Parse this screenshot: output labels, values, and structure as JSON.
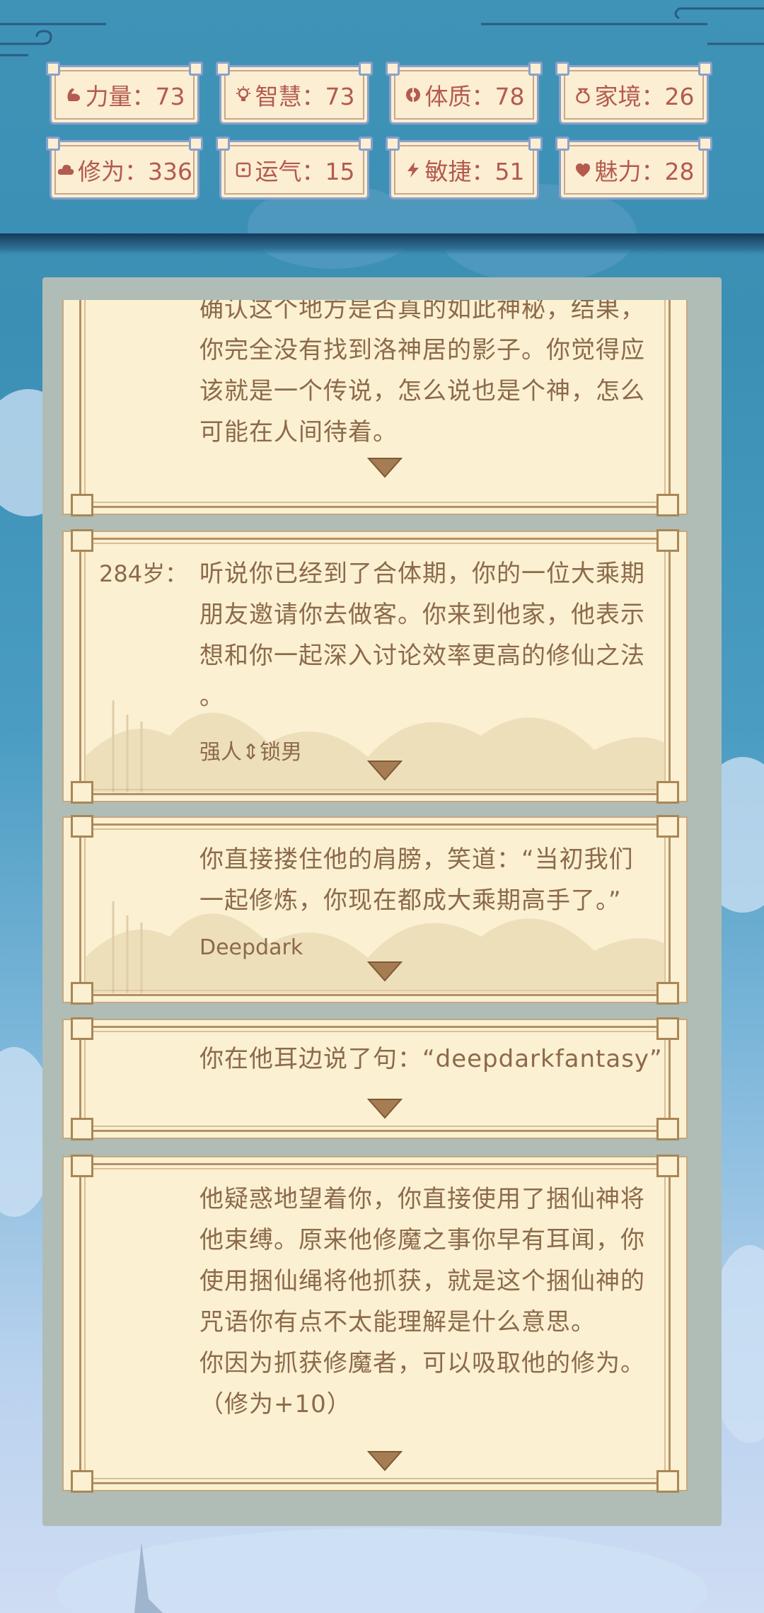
{
  "stats": [
    {
      "label": "力量：73",
      "icon": "muscle-icon"
    },
    {
      "label": "智慧：73",
      "icon": "lightbulb-icon"
    },
    {
      "label": "体质：78",
      "icon": "shield-circle-icon"
    },
    {
      "label": "家境：26",
      "icon": "money-bag-icon"
    },
    {
      "label": "修为：336",
      "icon": "cloud-icon"
    },
    {
      "label": "运气：15",
      "icon": "dice-icon"
    },
    {
      "label": "敏捷：51",
      "icon": "lightning-icon"
    },
    {
      "label": "魅力：28",
      "icon": "heart-icon"
    }
  ],
  "events": [
    {
      "age": "",
      "lines": [
        "确认这个地方是否真的如此神秘，结果，",
        "你完全没有找到洛神居的影子。你觉得应",
        "该就是一个传说，怎么说也是个神，怎么",
        "可能在人间待着。"
      ],
      "sub": ""
    },
    {
      "age": "284岁：",
      "lines": [
        "听说你已经到了合体期，你的一位大乘期",
        "朋友邀请你去做客。你来到他家，他表示",
        "想和你一起深入讨论效率更高的修仙之法",
        "。"
      ],
      "sub": "强人⇕锁男"
    },
    {
      "age": "",
      "lines": [
        "你直接搂住他的肩膀，笑道：“当初我们",
        "一起修炼，你现在都成大乘期高手了。”"
      ],
      "sub": "Deepdark"
    },
    {
      "age": "",
      "lines": [
        "你在他耳边说了句：“deepdarkfantasy”"
      ],
      "sub": ""
    },
    {
      "age": "",
      "lines": [
        "他疑惑地望着你，你直接使用了捆仙神将",
        "他束缚。原来他修魔之事你早有耳闻，你",
        "使用捆仙绳将他抓获，就是这个捆仙神的",
        "咒语你有点不太能理解是什么意思。",
        "你因为抓获修魔者，可以吸取他的修为。",
        "（修为+10）"
      ],
      "sub": ""
    }
  ],
  "colors": {
    "stat_text": "#b45a4e",
    "card_bg": "#fbf0d2",
    "text": "#8c6a4a",
    "arrow": "#a67c52"
  }
}
